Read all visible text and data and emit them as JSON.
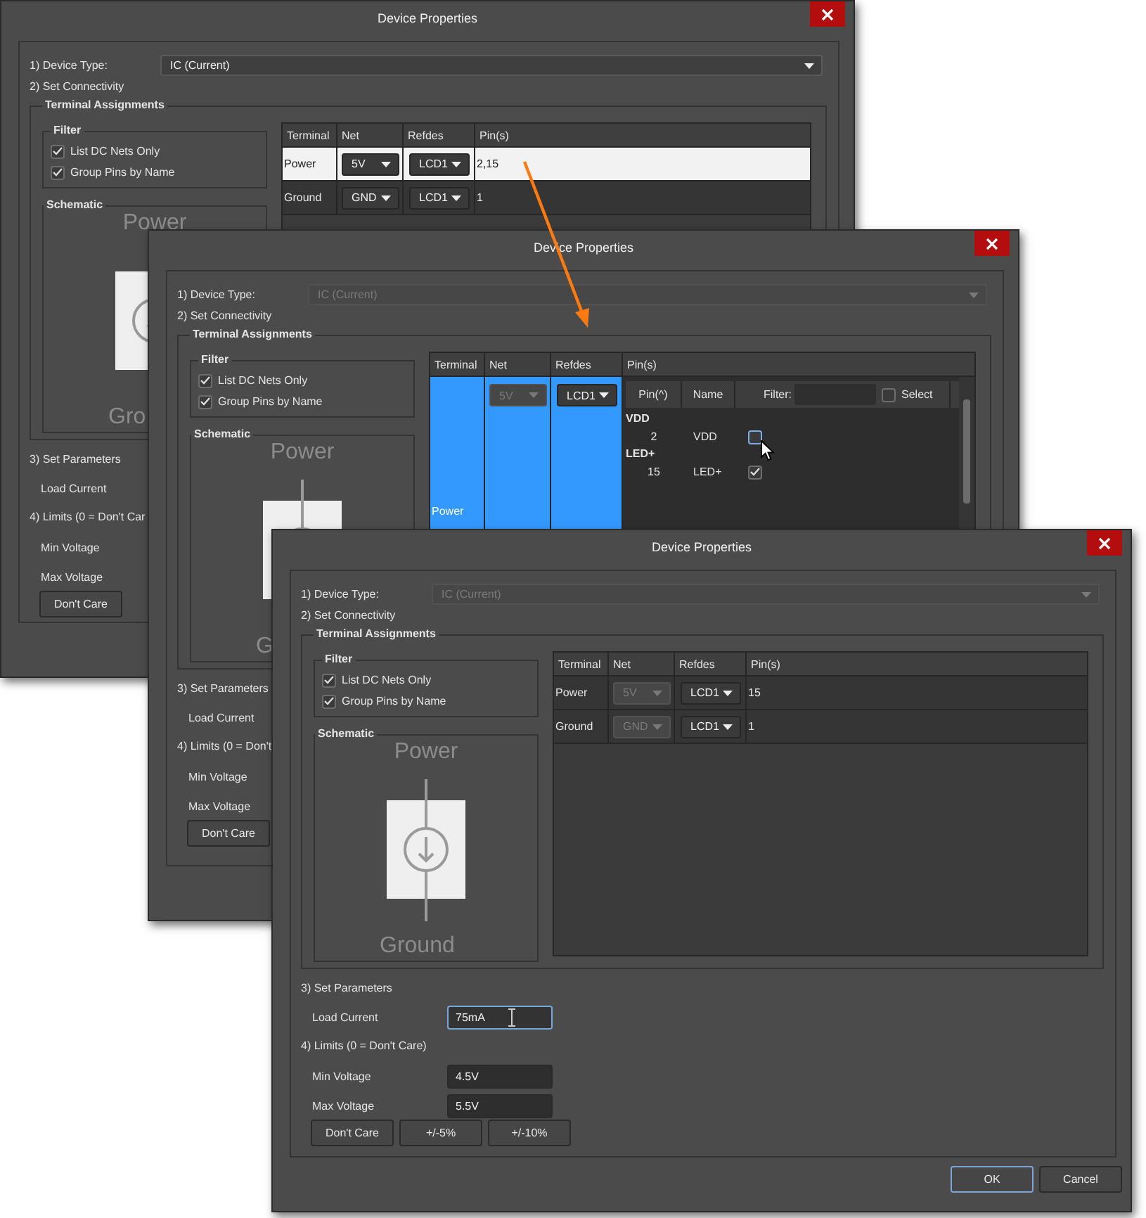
{
  "windows": [
    {
      "title": "Device Properties",
      "device_type": {
        "label": "1) Device Type:",
        "value": "IC (Current)",
        "disabled": false
      },
      "connectivity_label": "2) Set Connectivity",
      "terminal_assignments": {
        "title": "Terminal Assignments",
        "filter": {
          "title": "Filter",
          "options": [
            {
              "label": "List DC Nets Only",
              "checked": true
            },
            {
              "label": "Group Pins by Name",
              "checked": true
            }
          ]
        },
        "schematic": {
          "title": "Schematic",
          "top_label": "Power",
          "bottom_label": "Gro"
        },
        "table": {
          "columns": [
            "Terminal",
            "Net",
            "Refdes",
            "Pin(s)"
          ],
          "rows": [
            {
              "kind": "plain",
              "terminal": "Power",
              "net": {
                "value": "5V",
                "disabled": false
              },
              "refdes": "LCD1",
              "pins": "2,15",
              "selected": true
            },
            {
              "kind": "plain",
              "terminal": "Ground",
              "net": {
                "value": "GND",
                "disabled": false
              },
              "refdes": "LCD1",
              "pins": "1",
              "selected": false
            }
          ]
        }
      },
      "parameters": {
        "title": "3) Set Parameters",
        "fields": [
          {
            "label": "Load Current"
          }
        ]
      },
      "limits": {
        "title": "4) Limits (0 = Don't Car",
        "fields": [
          {
            "label": "Min Voltage"
          },
          {
            "label": "Max Voltage"
          }
        ]
      },
      "limit_buttons": [
        "Don't Care"
      ]
    },
    {
      "title": "Device Properties",
      "device_type": {
        "label": "1) Device Type:",
        "value": "IC (Current)",
        "disabled": true
      },
      "connectivity_label": "2) Set Connectivity",
      "terminal_assignments": {
        "title": "Terminal Assignments",
        "filter": {
          "title": "Filter",
          "options": [
            {
              "label": "List DC Nets Only",
              "checked": true
            },
            {
              "label": "Group Pins by Name",
              "checked": true
            }
          ]
        },
        "schematic": {
          "title": "Schematic",
          "top_label": "Power",
          "bottom_label": "G"
        },
        "table": {
          "columns": [
            "Terminal",
            "Net",
            "Refdes",
            "Pin(s)"
          ],
          "rows": [
            {
              "kind": "editor",
              "terminal": "Power",
              "net": {
                "value": "5V",
                "disabled": true
              },
              "refdes": "LCD1",
              "selected": true,
              "pin_editor": {
                "columns": [
                  "Pin(^)",
                  "Name"
                ],
                "filter_label": "Filter:",
                "select": {
                  "label": "Select",
                  "checked": false
                },
                "groups": [
                  {
                    "name": "VDD",
                    "pins": [
                      {
                        "pin": "2",
                        "name": "VDD",
                        "checked": false,
                        "hovered": true
                      }
                    ]
                  },
                  {
                    "name": "LED+",
                    "pins": [
                      {
                        "pin": "15",
                        "name": "LED+",
                        "checked": true
                      }
                    ]
                  }
                ]
              }
            }
          ]
        }
      },
      "parameters": {
        "title": "3) Set Parameters",
        "fields": [
          {
            "label": "Load Current"
          }
        ]
      },
      "limits": {
        "title": "4) Limits (0 = Don't",
        "fields": [
          {
            "label": "Min Voltage"
          },
          {
            "label": "Max Voltage"
          }
        ]
      },
      "limit_buttons": [
        "Don't Care"
      ]
    },
    {
      "title": "Device Properties",
      "device_type": {
        "label": "1) Device Type:",
        "value": "IC (Current)",
        "disabled": true
      },
      "connectivity_label": "2) Set Connectivity",
      "terminal_assignments": {
        "title": "Terminal Assignments",
        "filter": {
          "title": "Filter",
          "options": [
            {
              "label": "List DC Nets Only",
              "checked": true
            },
            {
              "label": "Group Pins by Name",
              "checked": true
            }
          ]
        },
        "schematic": {
          "title": "Schematic",
          "top_label": "Power",
          "bottom_label": "Ground"
        },
        "table": {
          "columns": [
            "Terminal",
            "Net",
            "Refdes",
            "Pin(s)"
          ],
          "rows": [
            {
              "kind": "plain",
              "terminal": "Power",
              "net": {
                "value": "5V",
                "disabled": true
              },
              "refdes": "LCD1",
              "pins": "15",
              "selected": false
            },
            {
              "kind": "plain",
              "terminal": "Ground",
              "net": {
                "value": "GND",
                "disabled": true
              },
              "refdes": "LCD1",
              "pins": "1",
              "selected": false
            }
          ]
        }
      },
      "parameters": {
        "title": "3) Set Parameters",
        "fields": [
          {
            "label": "Load Current",
            "value": "75mA",
            "focused": true,
            "hovered": true
          }
        ]
      },
      "limits": {
        "title": "4) Limits (0 = Don't Care)",
        "fields": [
          {
            "label": "Min Voltage",
            "value": "4.5V",
            "focused": false
          },
          {
            "label": "Max Voltage",
            "value": "5.5V",
            "focused": false
          }
        ]
      },
      "limit_buttons": [
        "Don't Care",
        "+/-5%",
        "+/-10%"
      ],
      "footer_buttons": [
        {
          "label": "OK",
          "default": true
        },
        {
          "label": "Cancel",
          "default": false
        }
      ]
    }
  ]
}
